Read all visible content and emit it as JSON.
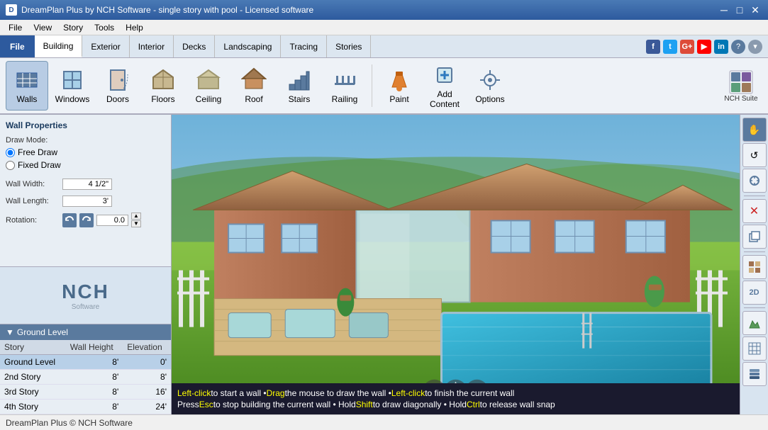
{
  "titlebar": {
    "title": "DreamPlan Plus by NCH Software - single story with pool - Licensed software",
    "icon": "D",
    "controls": [
      "—",
      "□",
      "✕"
    ]
  },
  "menubar": {
    "items": [
      "File",
      "View",
      "Story",
      "Tools",
      "Help"
    ]
  },
  "tabs": {
    "active": "Building",
    "items": [
      "File",
      "Building",
      "Exterior",
      "Interior",
      "Decks",
      "Landscaping",
      "Tracing",
      "Stories"
    ]
  },
  "ribbon": {
    "items": [
      {
        "id": "walls",
        "label": "Walls",
        "active": true
      },
      {
        "id": "windows",
        "label": "Windows"
      },
      {
        "id": "doors",
        "label": "Doors"
      },
      {
        "id": "floors",
        "label": "Floors"
      },
      {
        "id": "ceiling",
        "label": "Ceiling"
      },
      {
        "id": "roof",
        "label": "Roof"
      },
      {
        "id": "stairs",
        "label": "Stairs"
      },
      {
        "id": "railing",
        "label": "Railing"
      },
      {
        "id": "paint",
        "label": "Paint"
      },
      {
        "id": "add_content",
        "label": "Add Content"
      },
      {
        "id": "options",
        "label": "Options"
      }
    ],
    "nch_suite": "NCH Suite"
  },
  "wall_properties": {
    "title": "Wall Properties",
    "draw_mode_label": "Draw Mode:",
    "free_draw_label": "Free Draw",
    "fixed_draw_label": "Fixed Draw",
    "wall_width_label": "Wall Width:",
    "wall_width_value": "4 1/2\"",
    "wall_length_label": "Wall Length:",
    "wall_length_value": "3'",
    "rotation_label": "Rotation:",
    "rotation_value": "0.0"
  },
  "ground_level": {
    "title": "Ground Level",
    "columns": [
      "Story",
      "Wall Height",
      "Elevation"
    ],
    "rows": [
      {
        "story": "Ground Level",
        "wall_height": "8'",
        "elevation": "0'",
        "selected": true
      },
      {
        "story": "2nd Story",
        "wall_height": "8'",
        "elevation": "8'"
      },
      {
        "story": "3rd Story",
        "wall_height": "8'",
        "elevation": "16'"
      },
      {
        "story": "4th Story",
        "wall_height": "8'",
        "elevation": "24'"
      }
    ]
  },
  "right_toolbar": {
    "buttons": [
      {
        "id": "pointer",
        "icon": "✋",
        "active": true
      },
      {
        "id": "orbit",
        "icon": "↺"
      },
      {
        "id": "pan",
        "icon": "⟳"
      },
      {
        "id": "close-x",
        "icon": "✕"
      },
      {
        "id": "copy",
        "icon": "⎘"
      },
      {
        "id": "brick",
        "icon": "▦"
      },
      {
        "id": "2d",
        "icon": "2D"
      },
      {
        "id": "grid",
        "icon": "⊞"
      },
      {
        "id": "layers",
        "icon": "⊟"
      },
      {
        "id": "table",
        "icon": "⊞"
      }
    ]
  },
  "status_bar": {
    "line1_parts": [
      {
        "text": "Left-click",
        "type": "keyword"
      },
      {
        "text": " to start a wall • ",
        "type": "normal"
      },
      {
        "text": "Drag",
        "type": "keyword"
      },
      {
        "text": " the mouse to draw the wall • ",
        "type": "normal"
      },
      {
        "text": "Left-click",
        "type": "keyword"
      },
      {
        "text": " to finish the current wall",
        "type": "normal"
      }
    ],
    "line2_parts": [
      {
        "text": "Press ",
        "type": "normal"
      },
      {
        "text": "Esc",
        "type": "keyword"
      },
      {
        "text": " to stop building the current wall • Hold ",
        "type": "normal"
      },
      {
        "text": "Shift",
        "type": "keyword"
      },
      {
        "text": " to draw diagonally • Hold ",
        "type": "normal"
      },
      {
        "text": "Ctrl",
        "type": "keyword"
      },
      {
        "text": " to release wall snap",
        "type": "normal"
      }
    ]
  },
  "bottom_bar": {
    "text": "DreamPlan Plus © NCH Software"
  },
  "nch_logo": "NCH",
  "nch_software": "Software"
}
